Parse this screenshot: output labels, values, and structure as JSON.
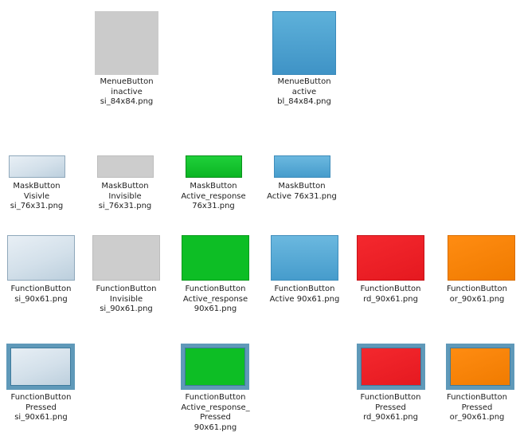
{
  "menue_inactive": {
    "line1": "MenueButton",
    "line2": "inactive",
    "line3": "si_84x84.png"
  },
  "menue_active": {
    "line1": "MenueButton",
    "line2": "active",
    "line3": "bl_84x84.png"
  },
  "mask_visible": {
    "line1": "MaskButton",
    "line2": "Visivle",
    "line3": "si_76x31.png"
  },
  "mask_invisible": {
    "line1": "MaskButton",
    "line2": "Invisible",
    "line3": "si_76x31.png"
  },
  "mask_active_response": {
    "line1": "MaskButton",
    "line2": "Active_response",
    "line3": "76x31.png"
  },
  "mask_active": {
    "line1": "MaskButton",
    "line2": "Active 76x31.png"
  },
  "fb_si": {
    "line1": "FunctionButton",
    "line2": "si_90x61.png"
  },
  "fb_invisible": {
    "line1": "FunctionButton",
    "line2": "Invisible",
    "line3": "si_90x61.png"
  },
  "fb_active_response": {
    "line1": "FunctionButton",
    "line2": "Active_response",
    "line3": "90x61.png"
  },
  "fb_active": {
    "line1": "FunctionButton",
    "line2": "Active 90x61.png"
  },
  "fb_rd": {
    "line1": "FunctionButton",
    "line2": "rd_90x61.png"
  },
  "fb_or": {
    "line1": "FunctionButton",
    "line2": "or_90x61.png"
  },
  "fb_pressed_si": {
    "line1": "FunctionButton",
    "line2": "Pressed",
    "line3": "si_90x61.png"
  },
  "fb_pressed_ar": {
    "line1": "FunctionButton",
    "line2": "Active_response_",
    "line3": "Pressed",
    "line4": "90x61.png"
  },
  "fb_pressed_rd": {
    "line1": "FunctionButton",
    "line2": "Pressed",
    "line3": "rd_90x61.png"
  },
  "fb_pressed_or": {
    "line1": "FunctionButton",
    "line2": "Pressed",
    "line3": "or_90x61.png"
  }
}
